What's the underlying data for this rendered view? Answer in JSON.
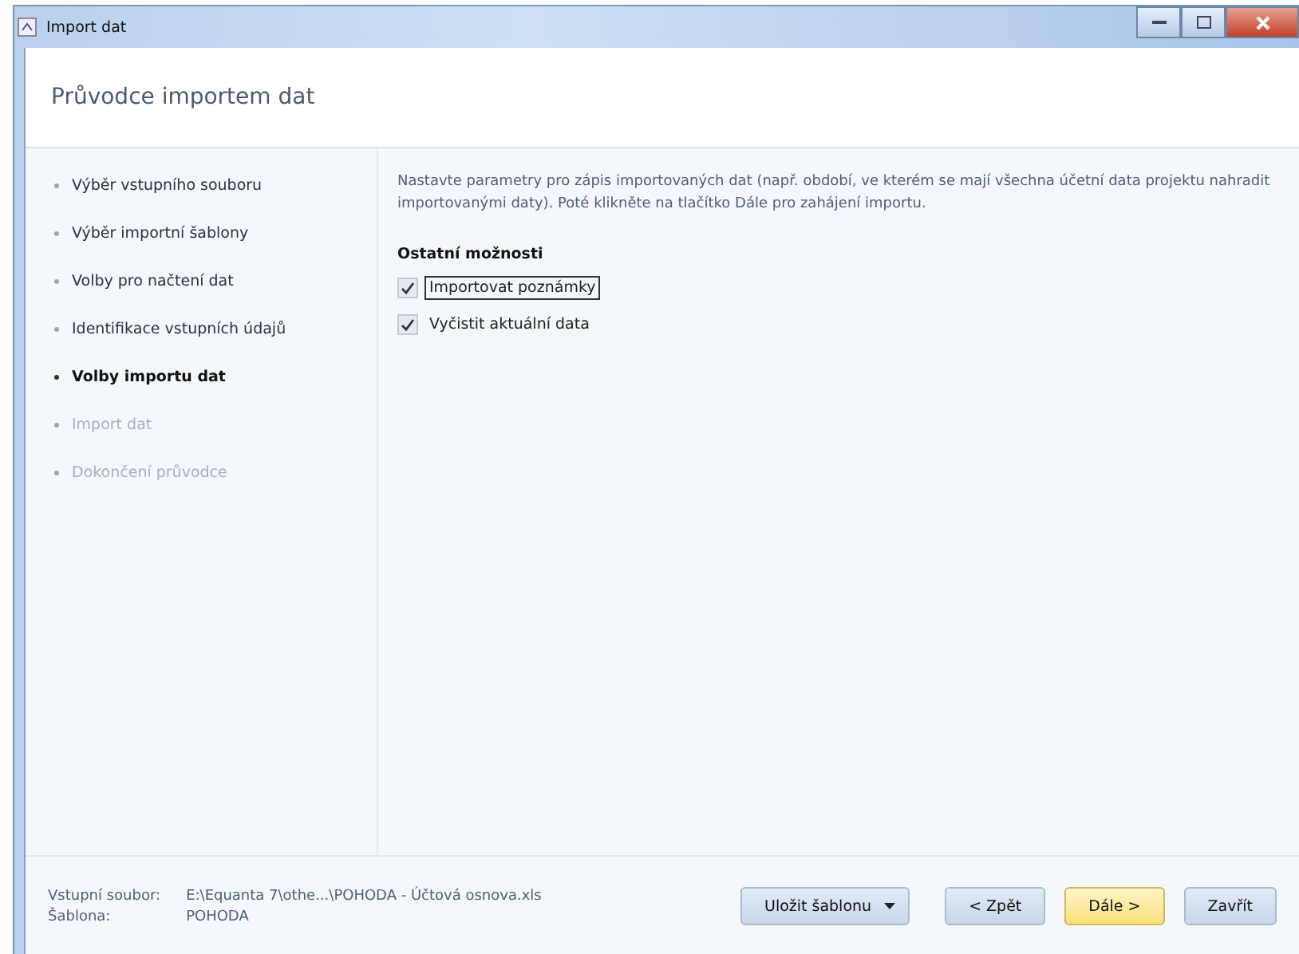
{
  "window": {
    "title": "Import dat"
  },
  "header": {
    "title": "Průvodce importem dat"
  },
  "steps": [
    {
      "label": "Výběr vstupního souboru",
      "selected": false,
      "disabled": false
    },
    {
      "label": "Výběr importní šablony",
      "selected": false,
      "disabled": false
    },
    {
      "label": "Volby pro načtení dat",
      "selected": false,
      "disabled": false
    },
    {
      "label": "Identifikace vstupních údajů",
      "selected": false,
      "disabled": false
    },
    {
      "label": "Volby importu dat",
      "selected": true,
      "disabled": false
    },
    {
      "label": "Import dat",
      "selected": false,
      "disabled": true
    },
    {
      "label": "Dokončení průvodce",
      "selected": false,
      "disabled": true
    }
  ],
  "content": {
    "description": "Nastavte parametry pro zápis importovaných dat (např. období, ve kterém se mají všechna účetní data projektu nahradit importovanými daty). Poté klikněte na tlačítko Dále pro zahájení importu.",
    "section_title": "Ostatní možnosti",
    "options": [
      {
        "label": "Importovat poznámky",
        "checked": true,
        "focused": true
      },
      {
        "label": "Vyčistit aktuální data",
        "checked": true,
        "focused": false
      }
    ]
  },
  "footer": {
    "info": [
      {
        "label": "Vstupní soubor:",
        "value": "E:\\Equanta 7\\othe...\\POHODA - Účtová osnova.xls"
      },
      {
        "label": "Šablona:",
        "value": "POHODA"
      }
    ],
    "buttons": [
      {
        "label": "Uložit šablonu",
        "kind": "dropdown",
        "default": false
      },
      {
        "label": "< Zpět",
        "kind": "plain",
        "default": false
      },
      {
        "label": "Dále >",
        "kind": "plain",
        "default": true
      },
      {
        "label": "Zavřít",
        "kind": "plain",
        "default": false
      }
    ]
  }
}
